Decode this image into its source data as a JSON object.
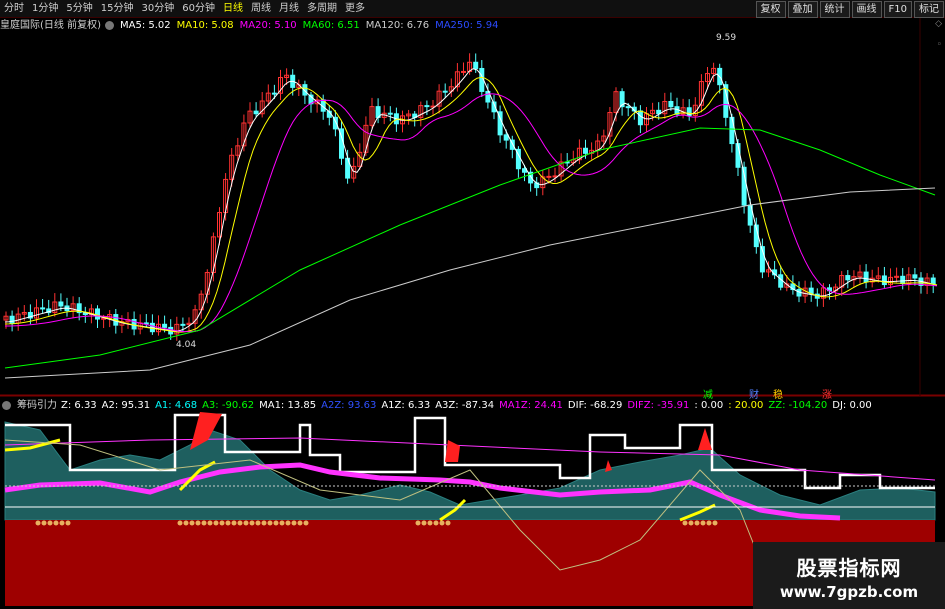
{
  "colors": {
    "up": "#ff3232",
    "down": "#54ffff",
    "ma5": "#ffffff",
    "ma10": "#ffff00",
    "ma20": "#ff00ff",
    "ma60": "#00ff00",
    "ma120": "#cccccc",
    "ma250": "#2b4bff",
    "teal": "#1e5f5f",
    "band": "#9e0000",
    "pink": "#ff33ff"
  },
  "toolbar": {
    "timeframes": [
      "分时",
      "1分钟",
      "5分钟",
      "15分钟",
      "30分钟",
      "60分钟",
      "日线",
      "周线",
      "月线",
      "多周期",
      "更多"
    ],
    "active": "日线",
    "buttons": [
      "复权",
      "叠加",
      "统计",
      "画线",
      "F10",
      "标记"
    ]
  },
  "price_legend": {
    "title": "皇庭国际(日线 前复权)",
    "ma": [
      {
        "label": "MA5: 5.02",
        "color": "#ffffff"
      },
      {
        "label": "MA10: 5.08",
        "color": "#ffff00"
      },
      {
        "label": "MA20: 5.10",
        "color": "#ff00ff"
      },
      {
        "label": "MA60: 6.51",
        "color": "#00ff00"
      },
      {
        "label": "MA120: 6.76",
        "color": "#cccccc"
      },
      {
        "label": "MA250: 5.94",
        "color": "#2b4bff"
      }
    ]
  },
  "price_marks": {
    "high": "9.59",
    "low": "4.04"
  },
  "signals": [
    {
      "text": "减",
      "color": "#00ff00"
    },
    {
      "text": "财",
      "color": "#5080ff"
    },
    {
      "text": "稳",
      "color": "#ffcc00"
    },
    {
      "text": "涨",
      "color": "#ff3232"
    }
  ],
  "indicator_legend": {
    "title": "筹码引力",
    "items": [
      {
        "label": "Z: 6.33",
        "color": "#ffffff"
      },
      {
        "label": "A2: 95.31",
        "color": "#ffffff"
      },
      {
        "label": "A1: 4.68",
        "color": "#00ffff"
      },
      {
        "label": "A3: -90.62",
        "color": "#00ff00"
      },
      {
        "label": "MA1: 13.85",
        "color": "#ffffff"
      },
      {
        "label": "A2Z: 93.63",
        "color": "#3050ff"
      },
      {
        "label": "A1Z: 6.33",
        "color": "#ffffff"
      },
      {
        "label": "A3Z: -87.34",
        "color": "#ffffff"
      },
      {
        "label": "MA1Z: 24.41",
        "color": "#ff00ff"
      },
      {
        "label": "DIF: -68.29",
        "color": "#ffffff"
      },
      {
        "label": "DIFZ: -35.91",
        "color": "#ff00ff"
      },
      {
        "label": ": 0.00",
        "color": "#ffffff"
      },
      {
        "label": ": 20.00",
        "color": "#ffff00"
      },
      {
        "label": "ZZ: -104.20",
        "color": "#00ff00"
      },
      {
        "label": "DJ: 0.00",
        "color": "#ffffff"
      }
    ]
  },
  "watermark": {
    "line1": "股票指标网",
    "line2": "www.7gpzb.com"
  }
}
